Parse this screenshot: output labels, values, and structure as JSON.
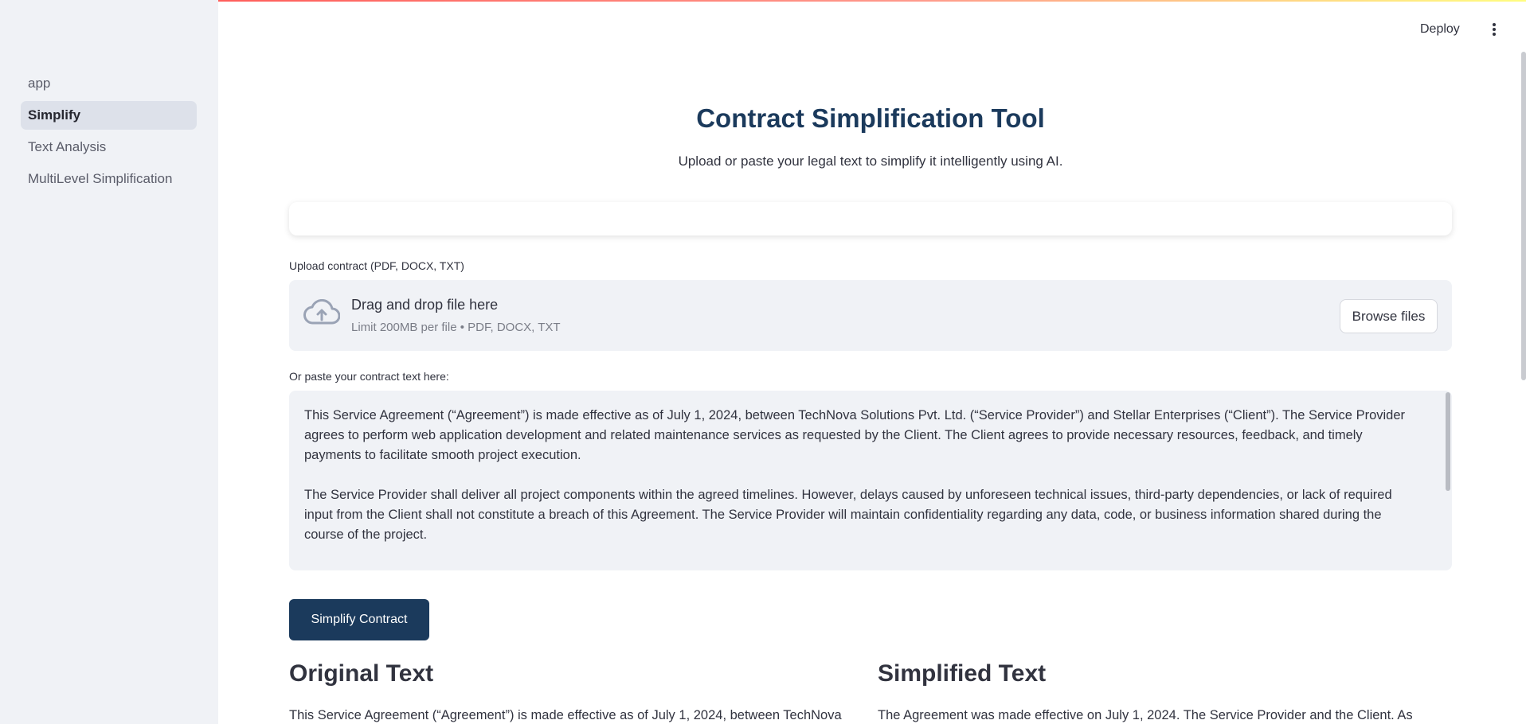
{
  "sidebar": {
    "items": [
      {
        "label": "app",
        "active": false
      },
      {
        "label": "Simplify",
        "active": true
      },
      {
        "label": "Text Analysis",
        "active": false
      },
      {
        "label": "MultiLevel Simplification",
        "active": false
      }
    ]
  },
  "header": {
    "deploy_label": "Deploy",
    "menu_icon": "more-vertical-icon"
  },
  "main": {
    "title": "Contract Simplification Tool",
    "subtitle": "Upload or paste your legal text to simplify it intelligently using AI.",
    "upload": {
      "label": "Upload contract (PDF, DOCX, TXT)",
      "drop_title": "Drag and drop file here",
      "drop_limit": "Limit 200MB per file • PDF, DOCX, TXT",
      "browse_label": "Browse files",
      "icon": "cloud-upload-icon"
    },
    "paste": {
      "label": "Or paste your contract text here:",
      "paragraph_1": "This Service Agreement (“Agreement”) is made effective as of July 1, 2024, between TechNova Solutions Pvt. Ltd. (“Service Provider”) and Stellar Enterprises (“Client”). The Service Provider agrees to perform web application development and related maintenance services as requested by the Client. The Client agrees to provide necessary resources, feedback, and timely payments to facilitate smooth project execution.",
      "paragraph_2": "The Service Provider shall deliver all project components within the agreed timelines. However, delays caused by unforeseen technical issues, third-party dependencies, or lack of required input from the Client shall not constitute a breach of this Agreement. The Service Provider will maintain confidentiality regarding any data, code, or business information shared during the course of the project."
    },
    "simplify_button": "Simplify Contract",
    "original": {
      "title": "Original Text",
      "text": "This Service Agreement (“Agreement”) is made effective as of July 1, 2024, between TechNova"
    },
    "simplified": {
      "title": "Simplified Text",
      "text": "The Agreement was made effective on July 1, 2024. The Service Provider and the Client. As"
    }
  },
  "colors": {
    "accent": "#1b3a5c",
    "sidebar_bg": "#f0f2f6",
    "input_bg": "#f0f2f6"
  }
}
